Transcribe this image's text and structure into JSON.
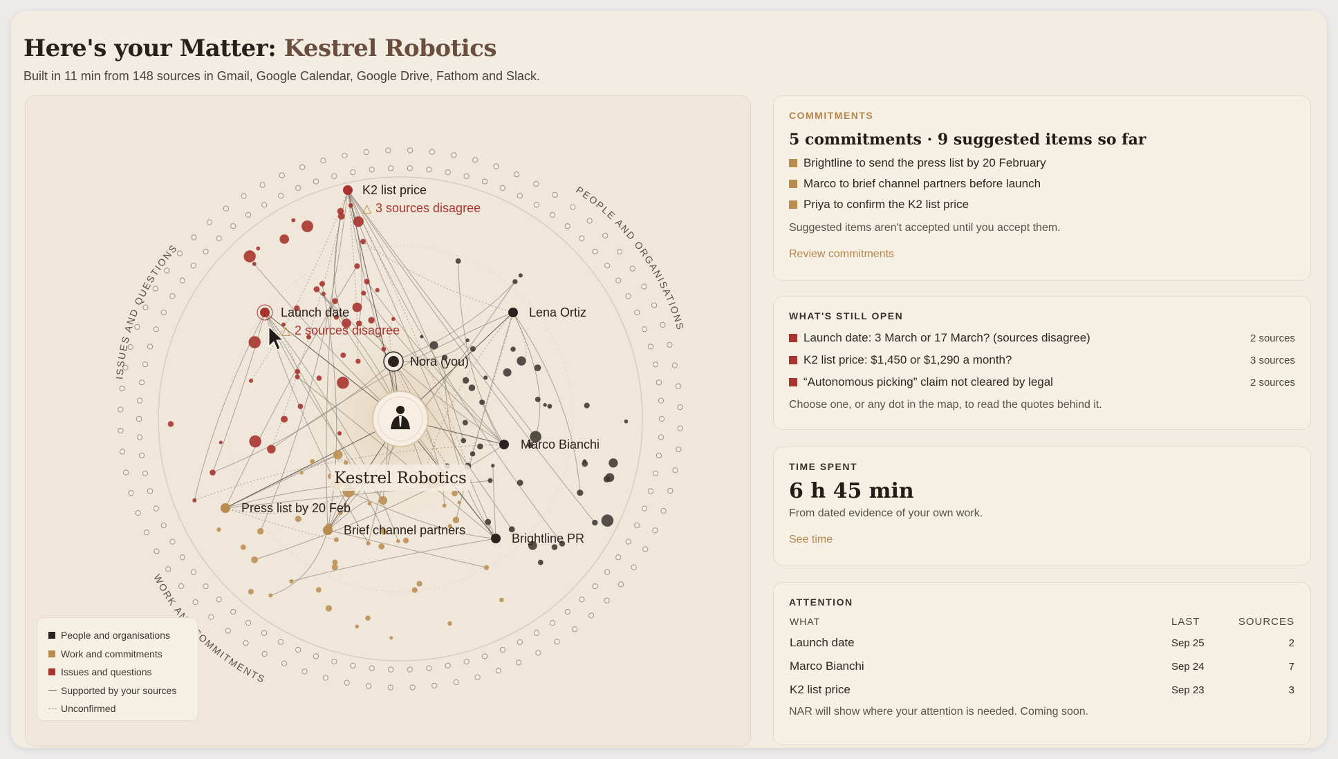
{
  "header": {
    "title_prefix": "Here's your Matter:",
    "title_name": "Kestrel Robotics",
    "subtitle": "Built in 11 min from 148 sources in Gmail, Google Calendar, Google Drive, Fathom and Slack."
  },
  "map": {
    "center_label": "Kestrel Robotics",
    "arc_labels": {
      "issues": "ISSUES AND QUESTIONS",
      "people": "PEOPLE AND ORGANISATIONS",
      "work": "WORK AND COMMITMENTS"
    },
    "nodes": {
      "k2_price": "K2 list price",
      "k2_disagree": "3 sources disagree",
      "launch_date": "Launch date",
      "launch_disagree": "2 sources disagree",
      "nora": "Nora (you)",
      "lena": "Lena Ortiz",
      "marco": "Marco Bianchi",
      "brightline": "Brightline PR",
      "press_list": "Press list by 20 Feb",
      "brief_partners": "Brief channel partners",
      "warning_glyph": "△"
    },
    "legend": [
      {
        "label": "People and organisations",
        "color": "#2a2320"
      },
      {
        "label": "Work and commitments",
        "color": "#b98b4f"
      },
      {
        "label": "Issues and questions",
        "color": "#a9342f"
      },
      {
        "label": "Supported by your sources",
        "kind": "solid-line"
      },
      {
        "label": "Unconfirmed",
        "kind": "dashed-line"
      }
    ]
  },
  "commitments": {
    "eyebrow": "COMMITMENTS",
    "heading": "5 commitments · 9 suggested items so far",
    "items": [
      "Brightline to send the press list by 20 February",
      "Marco to brief channel partners before launch",
      "Priya to confirm the K2 list price"
    ],
    "note": "Suggested items aren't accepted until you accept them.",
    "link": "Review commitments"
  },
  "open": {
    "eyebrow": "WHAT'S STILL OPEN",
    "items": [
      {
        "text": "Launch date: 3 March or 17 March? (sources disagree)",
        "sources": "2 sources"
      },
      {
        "text": "K2 list price: $1,450 or $1,290 a month?",
        "sources": "3 sources"
      },
      {
        "text": "“Autonomous picking” claim not cleared by legal",
        "sources": "2 sources"
      }
    ],
    "note": "Choose one, or any dot in the map, to read the quotes behind it."
  },
  "time": {
    "eyebrow": "TIME SPENT",
    "value": "6 h 45 min",
    "note": "From dated evidence of your own work.",
    "link": "See time"
  },
  "attention": {
    "eyebrow": "ATTENTION",
    "columns": [
      "WHAT",
      "LAST",
      "SOURCES"
    ],
    "rows": [
      {
        "what": "Launch date",
        "last": "Sep 25",
        "sources": "2"
      },
      {
        "what": "Marco Bianchi",
        "last": "Sep 24",
        "sources": "7"
      },
      {
        "what": "K2 list price",
        "last": "Sep 23",
        "sources": "3"
      }
    ],
    "note": "NAR will show where your attention is needed. Coming soon."
  },
  "colors": {
    "people": "#2a2320",
    "work": "#b98b4f",
    "issues": "#a9342f",
    "accent": "#b5864a"
  }
}
